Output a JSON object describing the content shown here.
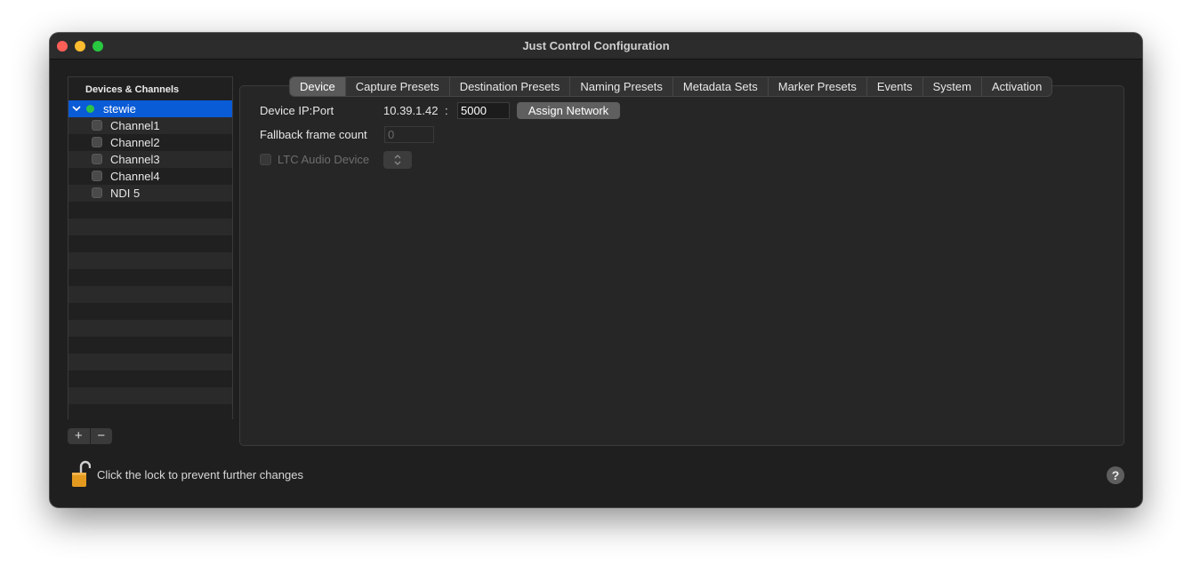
{
  "window": {
    "title": "Just Control Configuration"
  },
  "sidebar": {
    "header": "Devices & Channels",
    "device": {
      "name": "stewie",
      "status": "online",
      "status_color": "#2ec446"
    },
    "channels": [
      "Channel1",
      "Channel2",
      "Channel3",
      "Channel4",
      "NDI 5"
    ],
    "add_label": "+",
    "remove_label": "−"
  },
  "tabs": [
    "Device",
    "Capture Presets",
    "Destination Presets",
    "Naming Presets",
    "Metadata Sets",
    "Marker Presets",
    "Events",
    "System",
    "Activation"
  ],
  "active_tab": "Device",
  "device_tab": {
    "ip_port_label": "Device IP:Port",
    "ip": "10.39.1.42",
    "separator": ":",
    "port": "5000",
    "assign_button": "Assign Network",
    "fallback_label": "Fallback frame count",
    "fallback_value": "0",
    "ltc_label": "LTC Audio Device",
    "ltc_popup": "⌃⌄"
  },
  "footer": {
    "lock_text": "Click the lock to prevent further changes",
    "help": "?"
  },
  "colors": {
    "selection": "#0a5bd6",
    "window_bg": "#1f1f1f",
    "panel_bg": "#262626"
  }
}
